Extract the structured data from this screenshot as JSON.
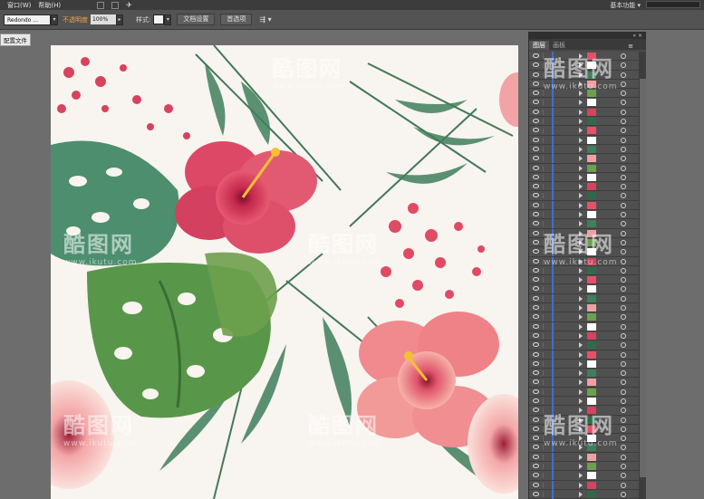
{
  "menubar": {
    "menu_window": "窗口(W)",
    "menu_help": "帮助(H)",
    "workspace": "基本功能"
  },
  "control": {
    "brush_name": "Redondo ...",
    "opacity_label": "不透明度",
    "opacity_value": "100%",
    "style_label": "样式:",
    "doc_setup": "文档设置",
    "preferences": "首选项"
  },
  "tooltip": "配置文件",
  "panel": {
    "tab_layers": "图层",
    "tab_artboards": "画板",
    "row_count": 48
  },
  "watermark": {
    "brand": "酷图网",
    "url": "www.ikutu.com"
  },
  "colors": {
    "selection_blue": "#3f6fd1",
    "opacity_orange": "#f0a24a"
  }
}
